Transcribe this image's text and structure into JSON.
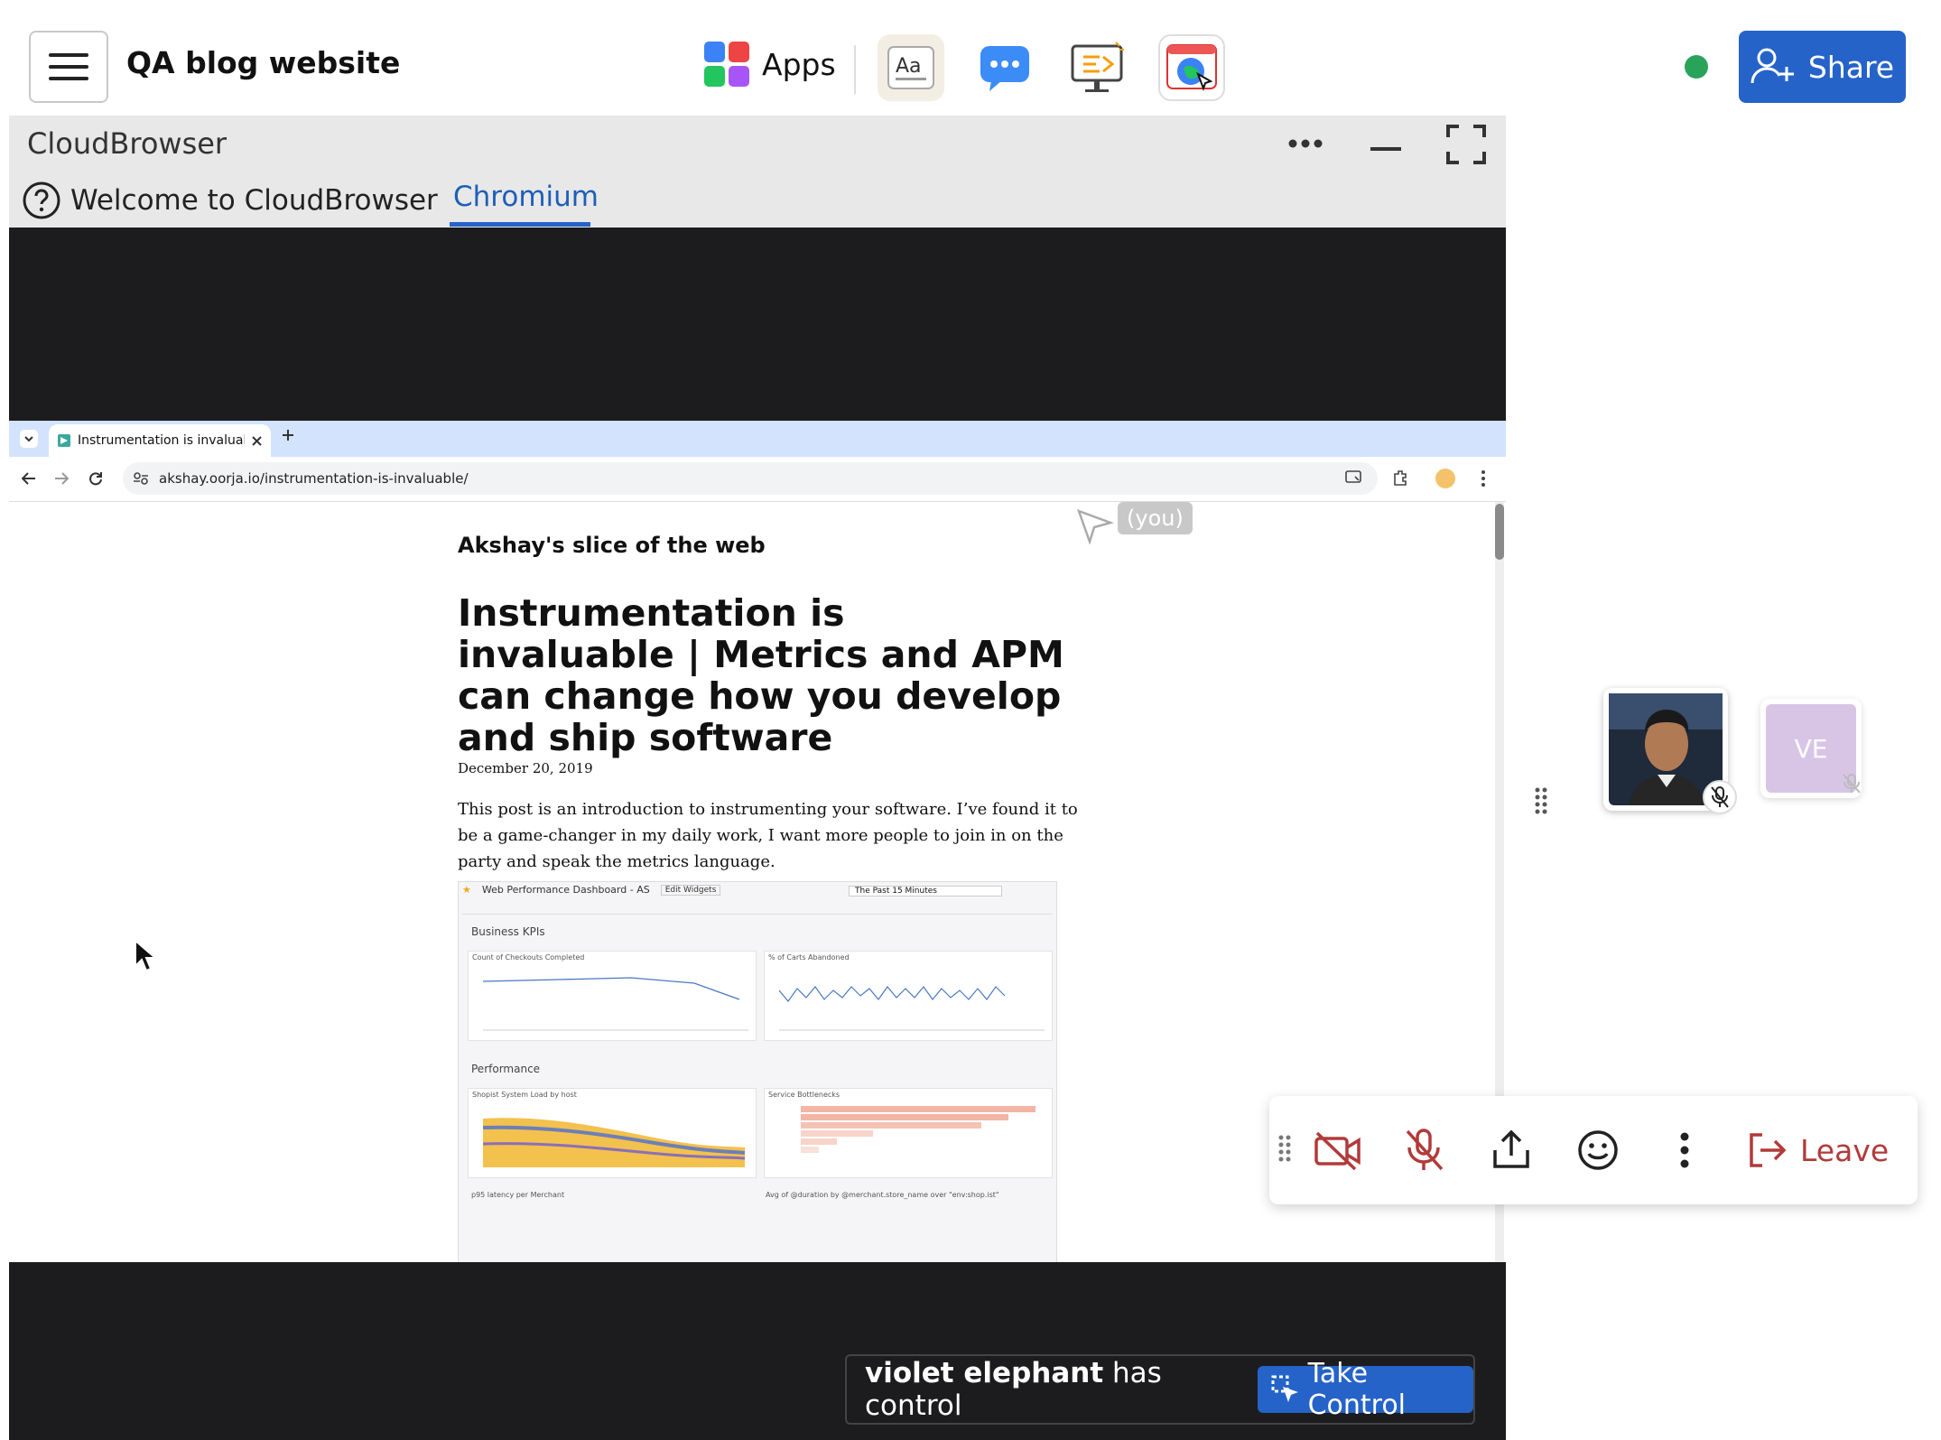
{
  "header": {
    "title": "QA blog website",
    "apps_label": "Apps",
    "share_label": "Share"
  },
  "window": {
    "title": "CloudBrowser",
    "tabs": [
      {
        "label": "Welcome to CloudBrowser",
        "active": false
      },
      {
        "label": "Chromium",
        "active": true
      }
    ]
  },
  "browser": {
    "tab_title": "Instrumentation is invaluab",
    "url": "akshay.oorja.io/instrumentation-is-invaluable/"
  },
  "blog": {
    "site_name": "Akshay's slice of the web",
    "post_title": "Instrumentation is invaluable | Metrics and APM can change how you develop and ship software",
    "date": "December 20, 2019",
    "intro": "This post is an introduction to instrumenting your software. I’ve found it to be a game-changer in my daily work, I want more people to join in on the party and speak the metrics language.",
    "dashboard": {
      "title": "Web Performance Dashboard - AS",
      "edit_label": "Edit Widgets",
      "time_range": "The Past 15 Minutes",
      "section1": "Business KPIs",
      "widget1": "Count of Checkouts Completed",
      "widget2": "% of Carts Abandoned",
      "section2": "Performance",
      "widget3": "Shopist System Load by host",
      "widget4": "Service Bottlenecks",
      "widget5": "p95 latency per Merchant",
      "widget6": "Avg of @duration by @merchant.store_name over \"env:shop.ist\""
    }
  },
  "cursor_tag": "(you)",
  "control": {
    "holder": "violet elephant",
    "suffix": " has control",
    "take_label": "Take Control"
  },
  "participants": {
    "second_initials": "VE"
  },
  "toolbar": {
    "leave_label": "Leave"
  },
  "colors": {
    "accent": "#2563c9",
    "danger": "#b23a3a",
    "online": "#2aa35a",
    "stage": "#1c1c1e"
  }
}
